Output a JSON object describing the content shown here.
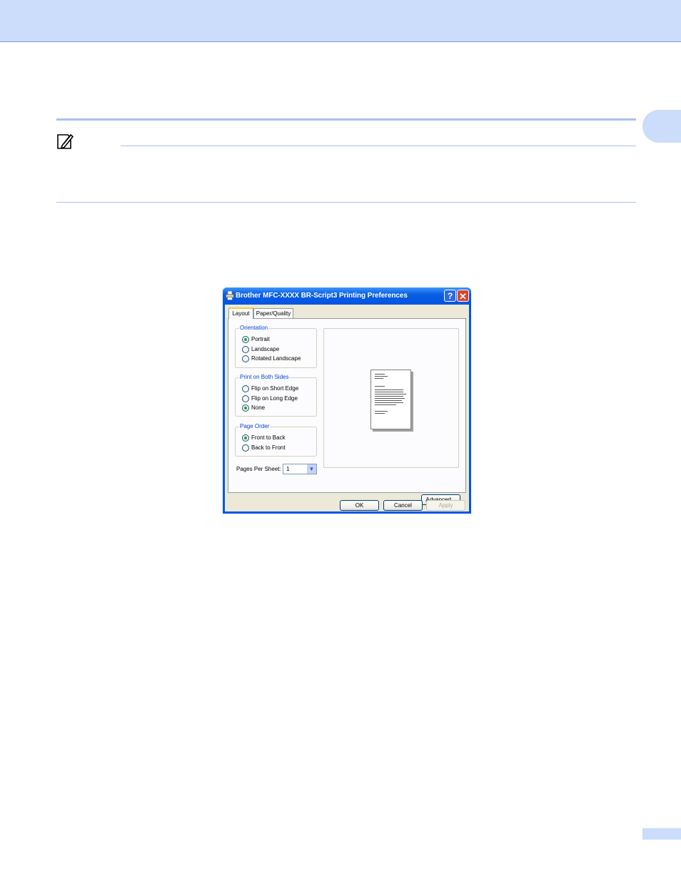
{
  "dialog": {
    "title": "Brother  MFC-XXXX  BR-Script3 Printing Preferences",
    "help_button": "?",
    "close_button": "✕",
    "tabs": [
      {
        "label": "Layout",
        "active": true
      },
      {
        "label": "Paper/Quality",
        "active": false
      }
    ],
    "orientation": {
      "label": "Orientation",
      "options": [
        {
          "label": "Portrait",
          "checked": true
        },
        {
          "label": "Landscape",
          "checked": false
        },
        {
          "label": "Rotated Landscape",
          "checked": false
        }
      ]
    },
    "print_on_both_sides": {
      "label": "Print on Both Sides",
      "options": [
        {
          "label": "Flip on Short Edge",
          "checked": false
        },
        {
          "label": "Flip on Long Edge",
          "checked": false
        },
        {
          "label": "None",
          "checked": true
        }
      ]
    },
    "page_order": {
      "label": "Page Order",
      "options": [
        {
          "label": "Front to Back",
          "checked": true
        },
        {
          "label": "Back to Front",
          "checked": false
        }
      ]
    },
    "pages_per_sheet": {
      "label": "Pages Per Sheet:",
      "value": "1"
    },
    "buttons": {
      "advanced": "Advanced...",
      "ok": "OK",
      "cancel": "Cancel",
      "apply": "Apply"
    }
  },
  "colors": {
    "header_band": "#ccdcfb",
    "rule": "#a9c0ef",
    "titlebar": "#0054e3",
    "group_label": "#0046d5"
  },
  "icons": {
    "note": "note-pencil-icon",
    "title": "printer-icon"
  }
}
